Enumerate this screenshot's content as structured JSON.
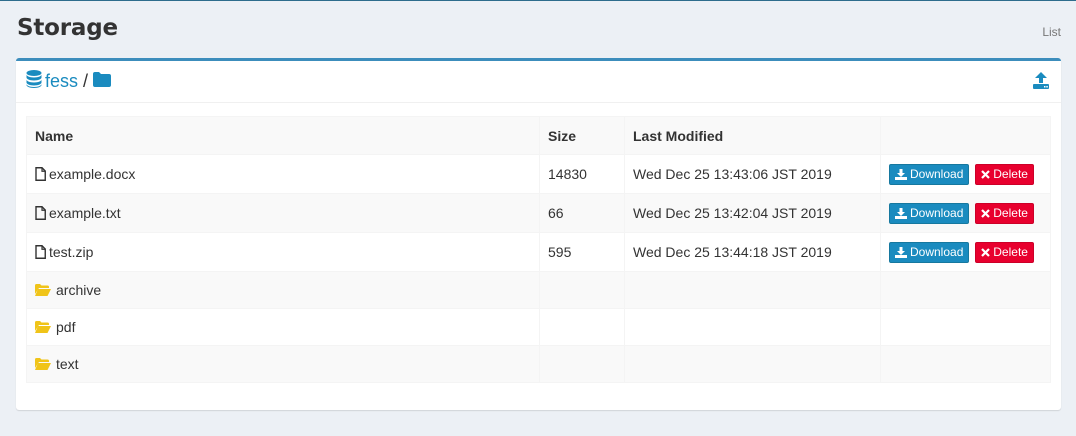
{
  "header": {
    "title": "Storage",
    "breadcrumb": "List"
  },
  "path": {
    "bucket": "fess",
    "separator": "/"
  },
  "table": {
    "columns": [
      "Name",
      "Size",
      "Last Modified",
      ""
    ],
    "files": [
      {
        "name": "example.docx",
        "size": "14830",
        "modified": "Wed Dec 25 13:43:06 JST 2019"
      },
      {
        "name": "example.txt",
        "size": "66",
        "modified": "Wed Dec 25 13:42:04 JST 2019"
      },
      {
        "name": "test.zip",
        "size": "595",
        "modified": "Wed Dec 25 13:44:18 JST 2019"
      }
    ],
    "folders": [
      {
        "name": "archive"
      },
      {
        "name": "pdf"
      },
      {
        "name": "text"
      }
    ]
  },
  "actions": {
    "download": "Download",
    "delete": "Delete"
  },
  "colors": {
    "accent": "#1a8bbf",
    "danger": "#e8002e",
    "folder": "#f0c419",
    "border_top": "#3c8dbc"
  }
}
